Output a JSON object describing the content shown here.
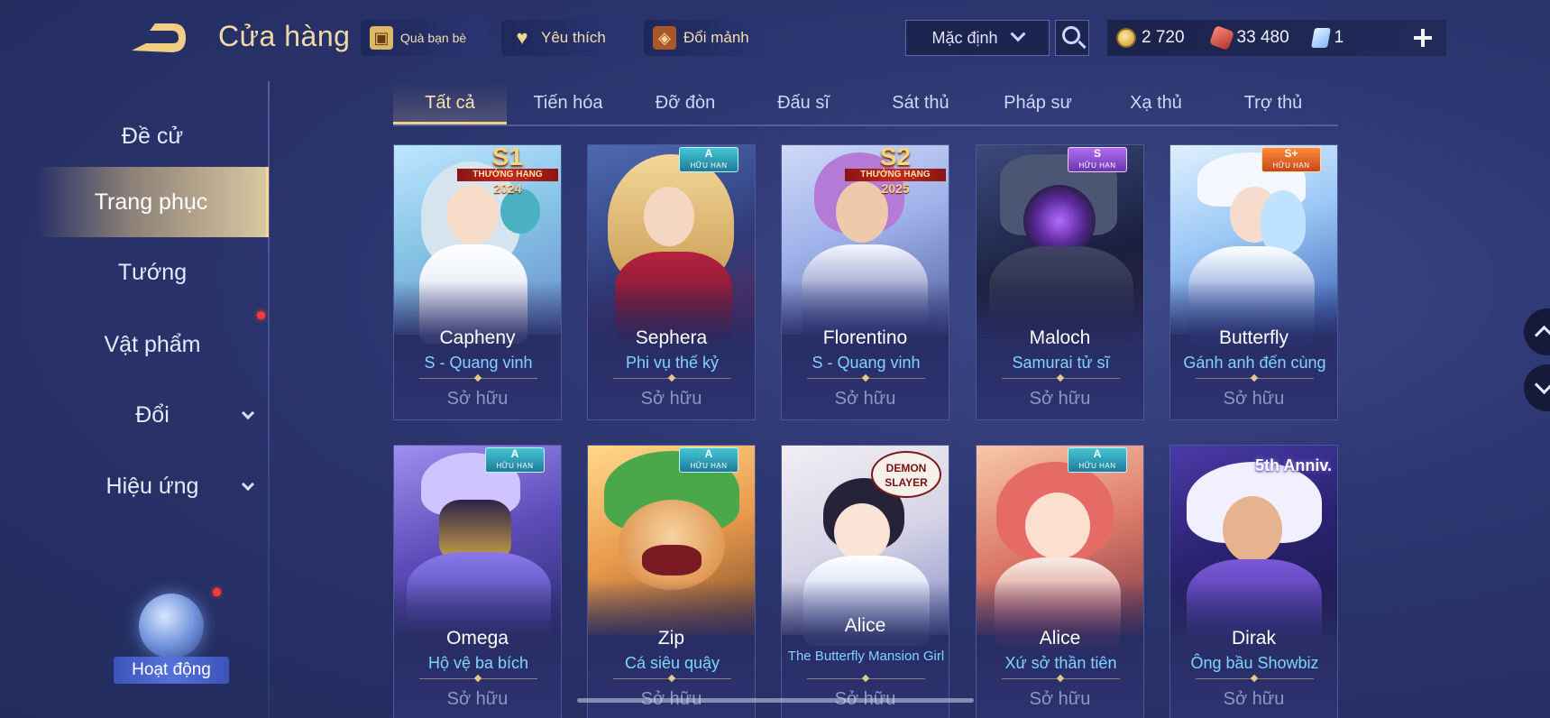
{
  "header": {
    "title": "Cửa hàng",
    "gift_label": "Quà bạn bè",
    "favorites_label": "Yêu thích",
    "exchange_label": "Đổi mảnh",
    "sort_value": "Mặc định"
  },
  "currencies": {
    "gold": "2 720",
    "vouchers": "33 480",
    "cards": "1"
  },
  "sidebar": {
    "items": [
      {
        "label": "Đề cử"
      },
      {
        "label": "Trang phục"
      },
      {
        "label": "Tướng"
      },
      {
        "label": "Vật phẩm"
      },
      {
        "label": "Đổi"
      },
      {
        "label": "Hiệu ứng"
      }
    ],
    "events_label": "Hoạt động"
  },
  "tabs": [
    "Tất cả",
    "Tiến hóa",
    "Đỡ đòn",
    "Đấu sĩ",
    "Sát thủ",
    "Pháp sư",
    "Xạ thủ",
    "Trợ thủ"
  ],
  "cards": [
    {
      "hero": "Capheny",
      "skin": "S - Quang vinh",
      "status": "Sở hữu",
      "season": "S1",
      "season_band": "THƯỞNG HẠNG",
      "year": "2024",
      "colors": [
        "#9fd4f0",
        "#e8f0ff",
        "#4aa8c6"
      ]
    },
    {
      "hero": "Sephera",
      "skin": "Phi vụ thế kỷ",
      "status": "Sở hữu",
      "tier": "A",
      "tier_sub": "HỮU HẠN",
      "colors": [
        "#3d4f8a",
        "#e9c480",
        "#b8233a"
      ]
    },
    {
      "hero": "Florentino",
      "skin": "S - Quang vinh",
      "status": "Sở hữu",
      "season": "S2",
      "season_band": "THƯỞNG HẠNG",
      "year": "2025",
      "colors": [
        "#a7c0ee",
        "#c58ae6",
        "#3e4c9a"
      ]
    },
    {
      "hero": "Maloch",
      "skin": "Samurai tử sĩ",
      "status": "Sở hữu",
      "tier": "S",
      "tier_sub": "HỮU HẠN",
      "colors": [
        "#1f2748",
        "#7d3bd1",
        "#4a5070"
      ]
    },
    {
      "hero": "Butterfly",
      "skin": "Gánh anh đến cùng",
      "status": "Sở hữu",
      "tier": "S+",
      "tier_sub": "HỮU HẠN",
      "colors": [
        "#8fc8ff",
        "#f2f5ff",
        "#2e67c8"
      ]
    },
    {
      "hero": "Omega",
      "skin": "Hộ vệ ba bích",
      "status": "Sở hữu",
      "tier": "A",
      "tier_sub": "HỮU HẠN",
      "colors": [
        "#5a4fb0",
        "#b7a8ff",
        "#d1a84a"
      ]
    },
    {
      "hero": "Zip",
      "skin": "Cá siêu quậy",
      "status": "Sở hữu",
      "tier": "A",
      "tier_sub": "HỮU HẠN",
      "colors": [
        "#d88a3e",
        "#3f9a3a",
        "#f2c36a"
      ]
    },
    {
      "hero": "Alice",
      "skin": "The Butterfly Mansion Girl",
      "status": "Sở hữu",
      "collab_line1": "DEMON",
      "collab_line2": "SLAYER",
      "colors": [
        "#e9e2ea",
        "#2a2440",
        "#6f8fd8"
      ]
    },
    {
      "hero": "Alice",
      "skin": "Xứ sở thần tiên",
      "status": "Sở hữu",
      "tier": "A",
      "tier_sub": "HỮU HẠN",
      "colors": [
        "#e8a08e",
        "#c84444",
        "#f5d9c8"
      ]
    },
    {
      "hero": "Dirak",
      "skin": "Ông bầu Showbiz",
      "status": "Sở hữu",
      "anniversary": "5th Anniv.",
      "colors": [
        "#3a2d8e",
        "#eae6ff",
        "#e7b04a"
      ]
    }
  ]
}
